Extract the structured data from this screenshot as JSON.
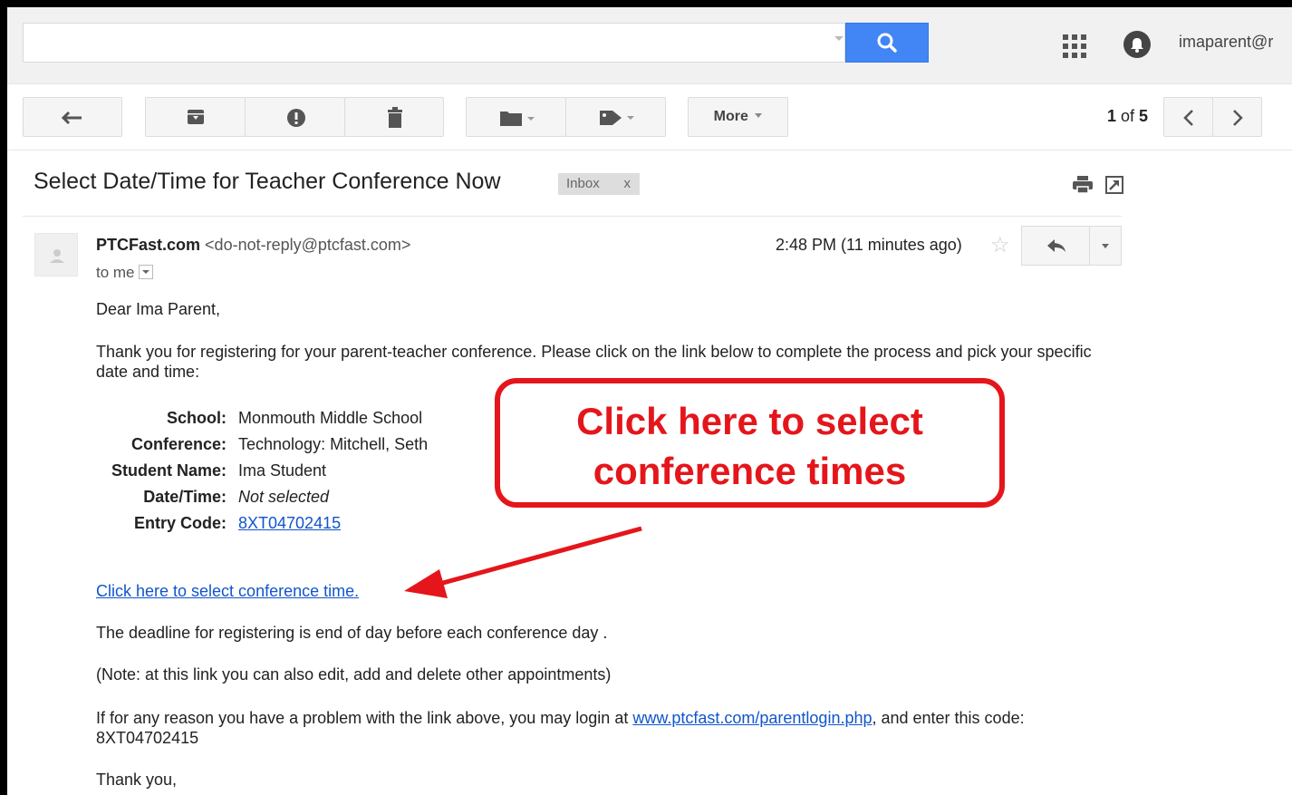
{
  "account": {
    "email": "imaparent@r"
  },
  "search": {
    "value": "",
    "placeholder": ""
  },
  "toolbar": {
    "back_icon": "arrow-left-icon",
    "archive_icon": "archive-icon",
    "spam_icon": "report-spam-icon",
    "delete_icon": "trash-icon",
    "move_icon": "folder-icon",
    "labels_icon": "tag-icon",
    "more_label": "More",
    "pager_current": "1",
    "pager_sep": " of ",
    "pager_total": "5"
  },
  "message": {
    "subject": "Select Date/Time for Teacher Conference Now",
    "label": "Inbox",
    "label_close": "x",
    "sender_name": "PTCFast.com",
    "sender_email": "<do-not-reply@ptcfast.com>",
    "recipient": "to me",
    "timestamp": "2:48 PM (11 minutes ago)",
    "greeting": "Dear Ima Parent,",
    "intro": "Thank you for registering for your parent-teacher conference. Please click on the link below to complete the process and pick your specific date and time:",
    "details": [
      {
        "label": "School:",
        "value": "Monmouth Middle School"
      },
      {
        "label": "Conference:",
        "value": "Technology: Mitchell, Seth"
      },
      {
        "label": "Student Name:",
        "value": "Ima Student"
      },
      {
        "label": "Date/Time:",
        "value": "Not selected"
      },
      {
        "label": "Entry Code:",
        "value": "8XT04702415"
      }
    ],
    "main_link": "Click here to select conference time.",
    "deadline": "The deadline for registering is end of day before each conference day .",
    "note": "(Note: at this link you can also edit, add and delete other appointments)",
    "problem_before": "If for any reason you have a problem with the link above, you may login at ",
    "problem_link": "www.ptcfast.com/parentlogin.php",
    "problem_after": ", and enter this code: 8XT04702415",
    "thanks": "Thank you,"
  },
  "annotation": {
    "line1": "Click here to select",
    "line2": "conference times",
    "color": "#e4161b"
  },
  "colors": {
    "link": "#1155cc",
    "search_button": "#4285f4"
  }
}
